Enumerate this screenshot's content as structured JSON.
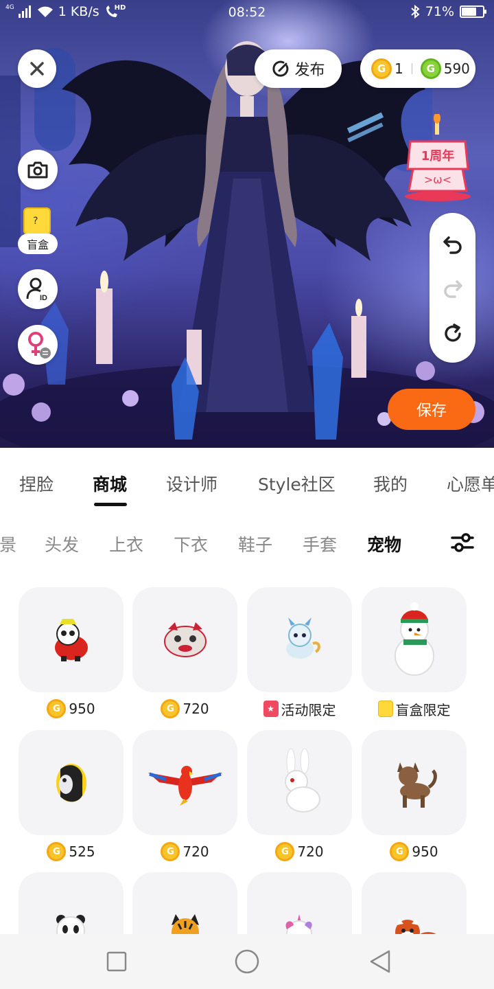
{
  "status_bar": {
    "network": "4G",
    "speed": "1 KB/s",
    "hd": "HD",
    "time": "08:52",
    "battery_text": "71%",
    "battery_level": 0.71
  },
  "top_actions": {
    "publish_label": "发布",
    "gold_coins": "1",
    "green_coins": "590"
  },
  "side_actions": {
    "blindbox_label": "盲盒"
  },
  "anniversary_badge": {
    "label": "1周年"
  },
  "save_label": "保存",
  "main_tabs": [
    {
      "label": "捏脸"
    },
    {
      "label": "商城"
    },
    {
      "label": "设计师"
    },
    {
      "label": "Style社区"
    },
    {
      "label": "我的"
    },
    {
      "label": "心愿单"
    }
  ],
  "active_main_tab": "商城",
  "sub_tabs": [
    {
      "label": "背景"
    },
    {
      "label": "头发"
    },
    {
      "label": "上衣"
    },
    {
      "label": "下衣"
    },
    {
      "label": "鞋子"
    },
    {
      "label": "手套"
    },
    {
      "label": "宠物"
    }
  ],
  "active_sub_tab": "宠物",
  "items": [
    {
      "name": "panda-in-red-outfit",
      "price": "950",
      "tag": "coin"
    },
    {
      "name": "lion-dance-cat",
      "price": "720",
      "tag": "coin"
    },
    {
      "name": "blue-qilin",
      "price": "活动限定",
      "tag": "event"
    },
    {
      "name": "snowman",
      "price": "盲盒限定",
      "tag": "blindbox"
    },
    {
      "name": "clownfish",
      "price": "525",
      "tag": "coin"
    },
    {
      "name": "red-parrot",
      "price": "720",
      "tag": "coin"
    },
    {
      "name": "white-rabbit",
      "price": "720",
      "tag": "coin"
    },
    {
      "name": "brown-cat",
      "price": "950",
      "tag": "coin"
    },
    {
      "name": "panda",
      "price": "",
      "tag": "none"
    },
    {
      "name": "tiger-cub",
      "price": "",
      "tag": "none"
    },
    {
      "name": "unicorn",
      "price": "",
      "tag": "none"
    },
    {
      "name": "red-panda",
      "price": "",
      "tag": "none"
    }
  ],
  "colors": {
    "accent_orange": "#fa6a14",
    "coin_gold": "#f7c42a",
    "coin_green": "#8ad23c",
    "event_red": "#f04a63",
    "card_bg": "#f4f4f7"
  }
}
